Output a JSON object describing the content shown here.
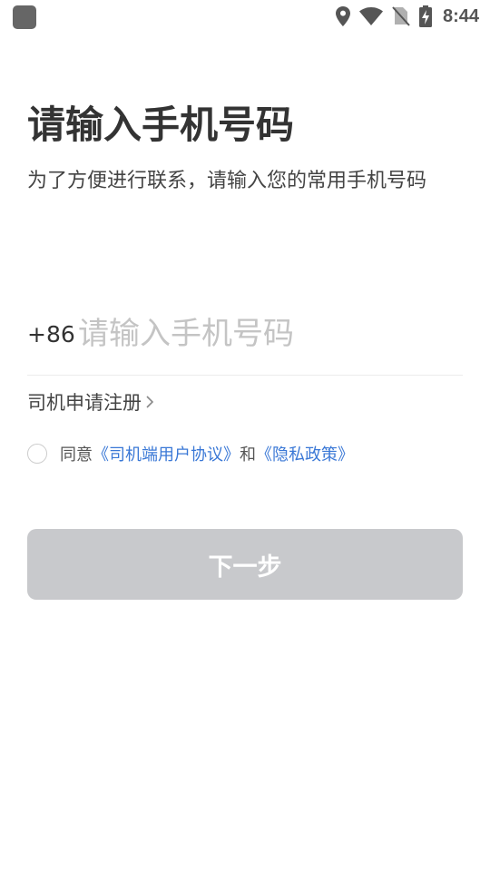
{
  "status_bar": {
    "time": "8:44",
    "icons": [
      "location-icon",
      "wifi-icon",
      "no-sim-icon",
      "battery-charging-icon"
    ]
  },
  "header": {
    "title": "请输入手机号码",
    "subtitle": "为了方便进行联系，请输入您的常用手机号码"
  },
  "phone": {
    "country_code": "+86",
    "value": "",
    "placeholder": "请输入手机号码"
  },
  "register": {
    "label": "司机申请注册"
  },
  "agreement": {
    "checked": false,
    "prefix": "同意",
    "user_agreement": "《司机端用户协议》",
    "conjunction": "和",
    "privacy_policy": "《隐私政策》"
  },
  "actions": {
    "next_label": "下一步"
  },
  "colors": {
    "link": "#3a78d6",
    "button_disabled": "#c8c9cc",
    "placeholder": "#c4c4c4"
  }
}
